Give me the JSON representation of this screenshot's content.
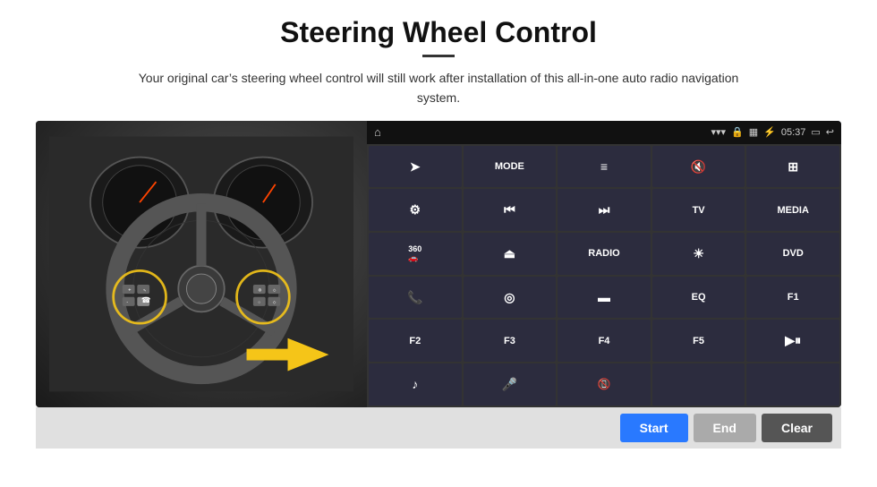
{
  "header": {
    "title": "Steering Wheel Control",
    "subtitle": "Your original car’s steering wheel control will still work after installation of this all-in-one auto radio navigation system."
  },
  "status_bar": {
    "time": "05:37",
    "icons": [
      "wifi",
      "lock",
      "sim",
      "bluetooth",
      "screen",
      "back"
    ]
  },
  "panel_buttons": [
    {
      "id": "nav",
      "icon": "➤",
      "text": "",
      "row": 1,
      "col": 1
    },
    {
      "id": "mode",
      "icon": "",
      "text": "MODE",
      "row": 1,
      "col": 2
    },
    {
      "id": "list",
      "icon": "≡",
      "text": "",
      "row": 1,
      "col": 3
    },
    {
      "id": "mute",
      "icon": "🔇",
      "text": "",
      "row": 1,
      "col": 4
    },
    {
      "id": "grid",
      "icon": "⊞",
      "text": "",
      "row": 1,
      "col": 5
    },
    {
      "id": "settings",
      "icon": "⚙",
      "text": "",
      "row": 2,
      "col": 1
    },
    {
      "id": "prev",
      "icon": "⏮",
      "text": "",
      "row": 2,
      "col": 2
    },
    {
      "id": "next",
      "icon": "⏭",
      "text": "",
      "row": 2,
      "col": 3
    },
    {
      "id": "tv",
      "icon": "",
      "text": "TV",
      "row": 2,
      "col": 4
    },
    {
      "id": "media",
      "icon": "",
      "text": "MEDIA",
      "row": 2,
      "col": 5
    },
    {
      "id": "cam360",
      "icon": "360",
      "text": "",
      "row": 3,
      "col": 1
    },
    {
      "id": "eject",
      "icon": "⏏",
      "text": "",
      "row": 3,
      "col": 2
    },
    {
      "id": "radio",
      "icon": "",
      "text": "RADIO",
      "row": 3,
      "col": 3
    },
    {
      "id": "brightness",
      "icon": "☀",
      "text": "",
      "row": 3,
      "col": 4
    },
    {
      "id": "dvd",
      "icon": "",
      "text": "DVD",
      "row": 3,
      "col": 5
    },
    {
      "id": "phone",
      "icon": "📞",
      "text": "",
      "row": 4,
      "col": 1
    },
    {
      "id": "gps",
      "icon": "◎",
      "text": "",
      "row": 4,
      "col": 2
    },
    {
      "id": "aspect",
      "icon": "▬",
      "text": "",
      "row": 4,
      "col": 3
    },
    {
      "id": "eq",
      "icon": "",
      "text": "EQ",
      "row": 4,
      "col": 4
    },
    {
      "id": "f1",
      "icon": "",
      "text": "F1",
      "row": 4,
      "col": 5
    },
    {
      "id": "f2",
      "icon": "",
      "text": "F2",
      "row": 5,
      "col": 1
    },
    {
      "id": "f3",
      "icon": "",
      "text": "F3",
      "row": 5,
      "col": 2
    },
    {
      "id": "f4",
      "icon": "",
      "text": "F4",
      "row": 5,
      "col": 3
    },
    {
      "id": "f5",
      "icon": "",
      "text": "F5",
      "row": 5,
      "col": 4
    },
    {
      "id": "playpause",
      "icon": "▶⏸",
      "text": "",
      "row": 5,
      "col": 5
    },
    {
      "id": "music",
      "icon": "♪",
      "text": "",
      "row": 6,
      "col": 1
    },
    {
      "id": "mic",
      "icon": "🎤",
      "text": "",
      "row": 6,
      "col": 2
    },
    {
      "id": "hangup",
      "icon": "📵",
      "text": "",
      "row": 6,
      "col": 3
    },
    {
      "id": "empty1",
      "icon": "",
      "text": "",
      "row": 6,
      "col": 4
    },
    {
      "id": "empty2",
      "icon": "",
      "text": "",
      "row": 6,
      "col": 5
    }
  ],
  "bottom_bar": {
    "start_label": "Start",
    "end_label": "End",
    "clear_label": "Clear"
  }
}
